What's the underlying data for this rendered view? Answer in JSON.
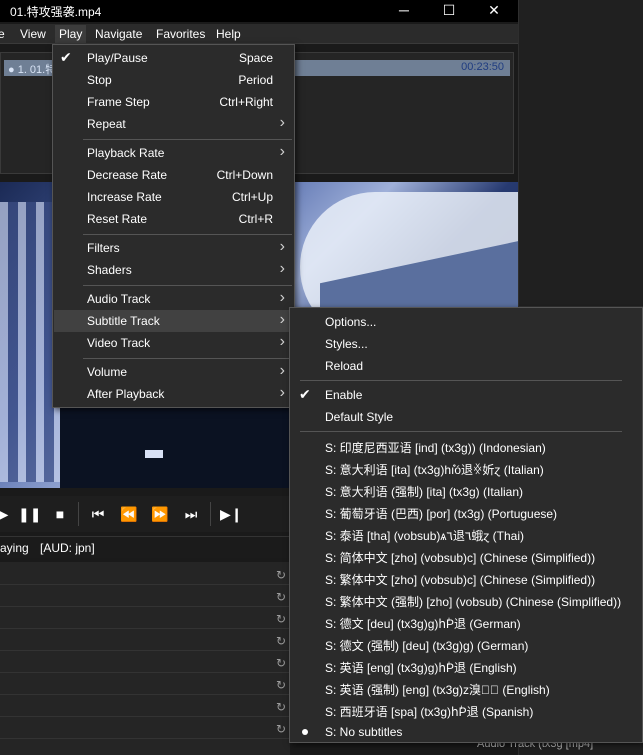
{
  "window": {
    "title": "01.特攻强袭.mp4",
    "minimize": "─",
    "maximize": "☐",
    "close": "✕"
  },
  "menubar": {
    "items": [
      "e",
      "View",
      "Play",
      "Navigate",
      "Favorites",
      "Help"
    ]
  },
  "playlist": {
    "item": "● 1. 01.特",
    "duration": "00:23:50"
  },
  "controls": {
    "play": "▶",
    "pause": "❚❚",
    "stop": "■",
    "prev": "⏮",
    "rewind": "⏪",
    "forward": "⏩",
    "next": "⏭",
    "frame_step": "▶❙"
  },
  "status": {
    "state": "aying",
    "audio": "[AUD: jpn]"
  },
  "play_menu": {
    "items": [
      {
        "label": "Play/Pause",
        "shortcut": "Space",
        "checked": true
      },
      {
        "label": "Stop",
        "shortcut": "Period"
      },
      {
        "label": "Frame Step",
        "shortcut": "Ctrl+Right"
      },
      {
        "label": "Repeat",
        "submenu": true
      },
      {
        "label": "Playback Rate",
        "submenu": true
      },
      {
        "label": "Decrease Rate",
        "shortcut": "Ctrl+Down"
      },
      {
        "label": "Increase Rate",
        "shortcut": "Ctrl+Up"
      },
      {
        "label": "Reset Rate",
        "shortcut": "Ctrl+R"
      },
      {
        "label": "Filters",
        "submenu": true
      },
      {
        "label": "Shaders",
        "submenu": true
      },
      {
        "label": "Audio Track",
        "submenu": true
      },
      {
        "label": "Subtitle Track",
        "submenu": true,
        "highlighted": true
      },
      {
        "label": "Video Track",
        "submenu": true
      },
      {
        "label": "Volume",
        "submenu": true
      },
      {
        "label": "After Playback",
        "submenu": true
      }
    ],
    "check_glyph": "✔",
    "arrow_glyph": "›"
  },
  "subtitle_menu": {
    "items": [
      {
        "label": "Options..."
      },
      {
        "label": "Styles..."
      },
      {
        "label": "Reload"
      },
      {
        "label": "Enable",
        "checked": true
      },
      {
        "label": "Default Style"
      },
      {
        "label": "S: 印度尼西亚语 [ind] (tx3g)) (Indonesian)"
      },
      {
        "label": "S: 意大利语 [ita] (tx3g)hıׁ̊̊ó退ꏍ妡ɀ (Italian)"
      },
      {
        "label": "S: 意大利语 (强制) [ita] (tx3g) (Italian)"
      },
      {
        "label": "S: 葡萄牙语 (巴西) [por] (tx3g) (Portuguese)"
      },
      {
        "label": "S: 泰语 [tha] (vobsub)ѧ٦退٦蛾ɀ (Thai)"
      },
      {
        "label": "S: 简体中文 [zho] (vobsub)c] (Chinese (Simplified))"
      },
      {
        "label": "S: 繁体中文 [zho] (vobsub)c] (Chinese (Simplified))"
      },
      {
        "label": "S: 繁体中文 (强制) [zho] (vobsub) (Chinese (Simplified))"
      },
      {
        "label": "S: 德文 [deu] (tx3g)g)hٰP退 (German)"
      },
      {
        "label": "S: 德文 (强制) [deu] (tx3g)g) (German)"
      },
      {
        "label": "S: 英语 [eng] (tx3g)g)hٰP退 (English)"
      },
      {
        "label": "S: 英语 (强制) [eng] (tx3g)z溴璐ٰ (English)"
      },
      {
        "label": "S: 西班牙语 [spa] (tx3g)hٰP退 (Spanish)"
      },
      {
        "label": "S: No subtitles",
        "selected": true
      }
    ],
    "check_glyph": "✔"
  },
  "background": {
    "right_text": "Audio Track (tx3g [mp4]",
    "refresh_glyph": "↻"
  }
}
